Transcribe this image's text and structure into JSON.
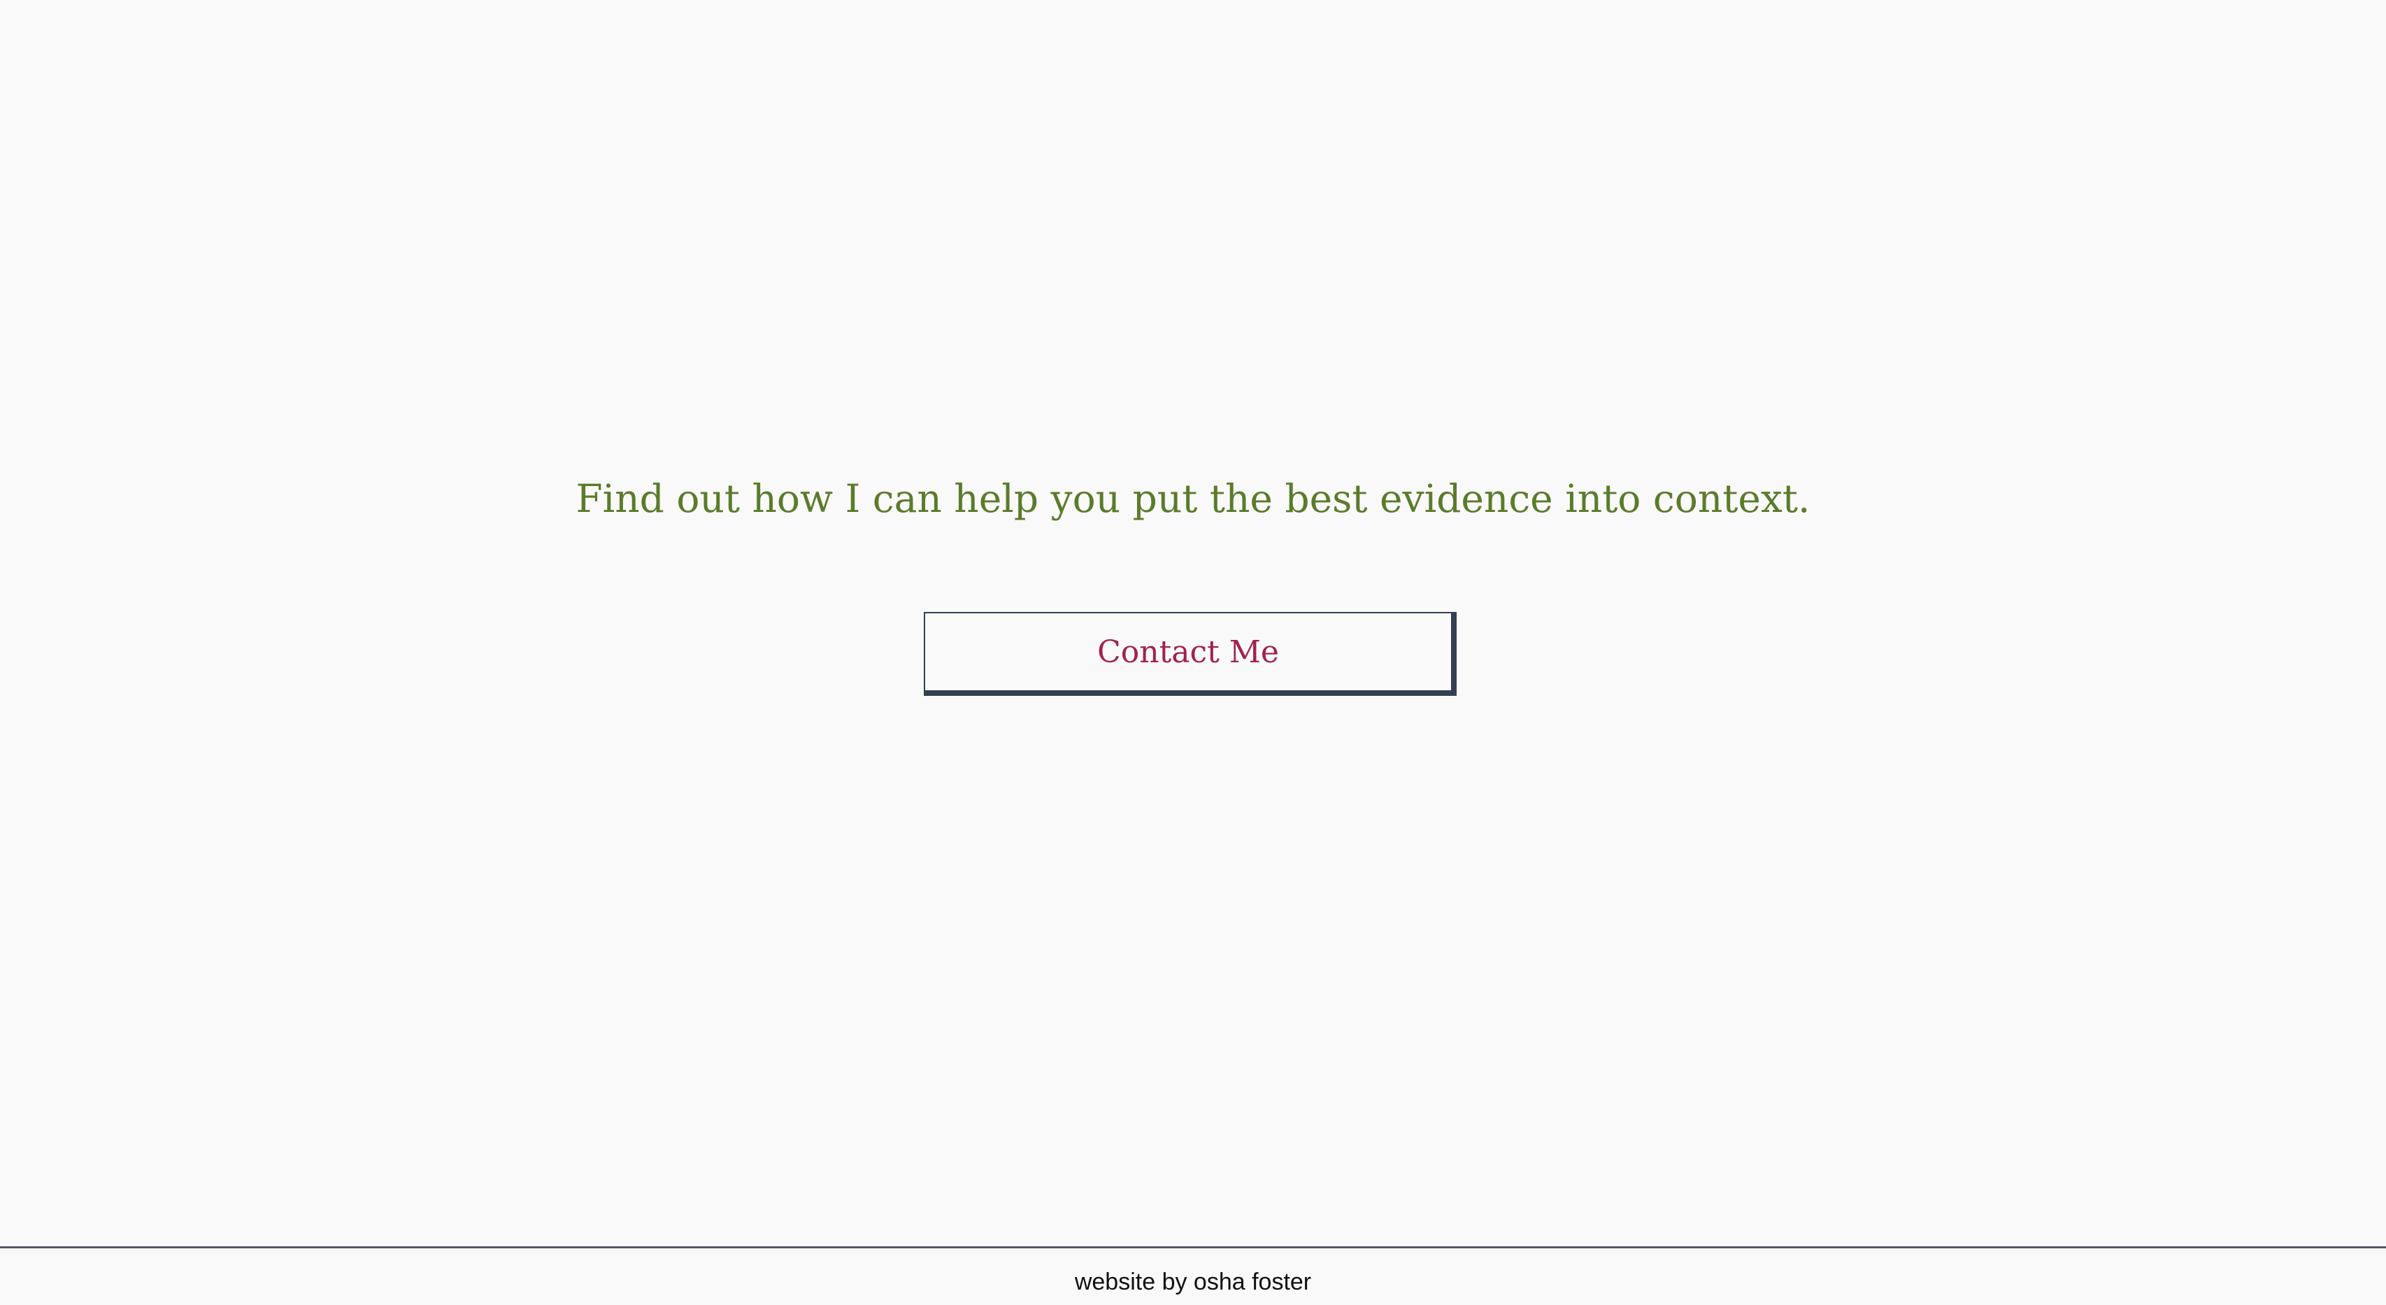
{
  "main": {
    "tagline": "Find out how I can help you put the best evidence into context.",
    "contact_button_label": "Contact Me"
  },
  "footer": {
    "credit": "website by osha foster"
  },
  "colors": {
    "background": "#f9f9f9",
    "tagline_text": "#5b7b2a",
    "button_text": "#a3204f",
    "button_border": "#343f52",
    "footer_rule": "#555a63"
  }
}
